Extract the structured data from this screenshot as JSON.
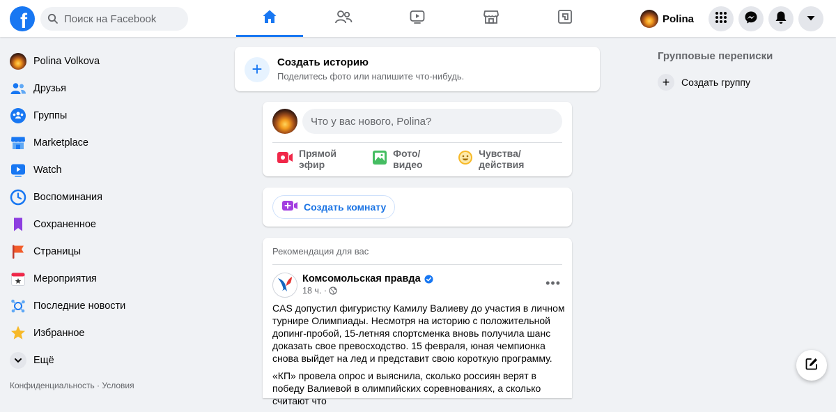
{
  "header": {
    "search_placeholder": "Поиск на Facebook",
    "logo": "f",
    "nav_tabs": [
      {
        "name": "home-icon",
        "active": true
      },
      {
        "name": "friends-icon",
        "active": false
      },
      {
        "name": "watch-icon",
        "active": false
      },
      {
        "name": "marketplace-icon",
        "active": false
      },
      {
        "name": "gaming-icon",
        "active": false
      }
    ],
    "user_name": "Polina",
    "right_icons": [
      "menu-grid-icon",
      "messenger-icon",
      "notifications-icon",
      "account-caret-icon"
    ]
  },
  "sidebar": {
    "items": [
      {
        "label": "Polina Volkova",
        "icon": "user-avatar"
      },
      {
        "label": "Друзья",
        "icon": "friends-icon"
      },
      {
        "label": "Группы",
        "icon": "groups-icon"
      },
      {
        "label": "Marketplace",
        "icon": "marketplace-icon"
      },
      {
        "label": "Watch",
        "icon": "watch-icon"
      },
      {
        "label": "Воспоминания",
        "icon": "memories-icon"
      },
      {
        "label": "Сохраненное",
        "icon": "saved-icon"
      },
      {
        "label": "Страницы",
        "icon": "pages-icon"
      },
      {
        "label": "Мероприятия",
        "icon": "events-icon"
      },
      {
        "label": "Последние новости",
        "icon": "news-icon"
      },
      {
        "label": "Избранное",
        "icon": "favorites-icon"
      },
      {
        "label": "Ещё",
        "icon": "chevron-down-icon"
      }
    ],
    "footer": "Конфиденциальность · Условия"
  },
  "feed": {
    "story": {
      "title": "Создать историю",
      "subtitle": "Поделитесь фото или напишите что-нибудь."
    },
    "composer": {
      "placeholder": "Что у вас нового, Polina?",
      "actions": [
        {
          "label": "Прямой эфир",
          "icon": "live-video-icon",
          "color": "#f02849"
        },
        {
          "label": "Фото/видео",
          "icon": "photo-icon",
          "color": "#45bd62"
        },
        {
          "label": "Чувства/действия",
          "icon": "feeling-icon",
          "color": "#f7b928"
        }
      ]
    },
    "room": {
      "label": "Создать комнату"
    },
    "post": {
      "recommendation": "Рекомендация для вас",
      "page_name": "Комсомольская правда",
      "time": "18 ч. ·",
      "paragraphs": [
        "CAS допустил фигуристку Камилу Валиеву до участия в личном турнире Олимпиады. Несмотря на историю с положительной допинг-пробой, 15-летняя спортсменка вновь получила шанс доказать свое превосходство. 15 февраля, юная чемпионка снова выйдет на лед и представит свою короткую программу.",
        "«КП» провела опрос и выяснила, сколько россиян верят в победу Валиевой в олимпийских соревнованиях, а сколько считают что"
      ]
    }
  },
  "right": {
    "title": "Групповые переписки",
    "create_group": "Создать группу"
  },
  "colors": {
    "brand": "#1877f2",
    "background": "#f0f2f5",
    "secondary_text": "#65676b"
  }
}
